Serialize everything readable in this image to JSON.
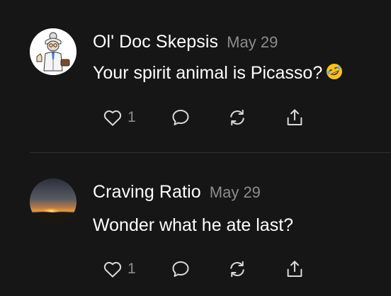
{
  "comments": [
    {
      "author": "Ol' Doc Skepsis",
      "date": "May 29",
      "text": "Your spirit animal is Picasso?",
      "emoji": "rolling-on-floor-laughing",
      "like_count": "1",
      "avatar": "cartoon-doctor-avatar"
    },
    {
      "author": "Craving Ratio",
      "date": "May 29",
      "text": "Wonder what he ate last?",
      "like_count": "1",
      "avatar": "sunset-avatar"
    }
  ],
  "icons": {
    "like": "heart-icon",
    "reply": "speech-bubble-icon",
    "restack": "restack-arrows-icon",
    "share": "share-upload-icon"
  },
  "colors": {
    "background": "#161616",
    "primary_text": "#ffffff",
    "secondary_text": "#8c8c8c",
    "icon": "#d9d9d9",
    "divider": "#2e2e2e"
  }
}
